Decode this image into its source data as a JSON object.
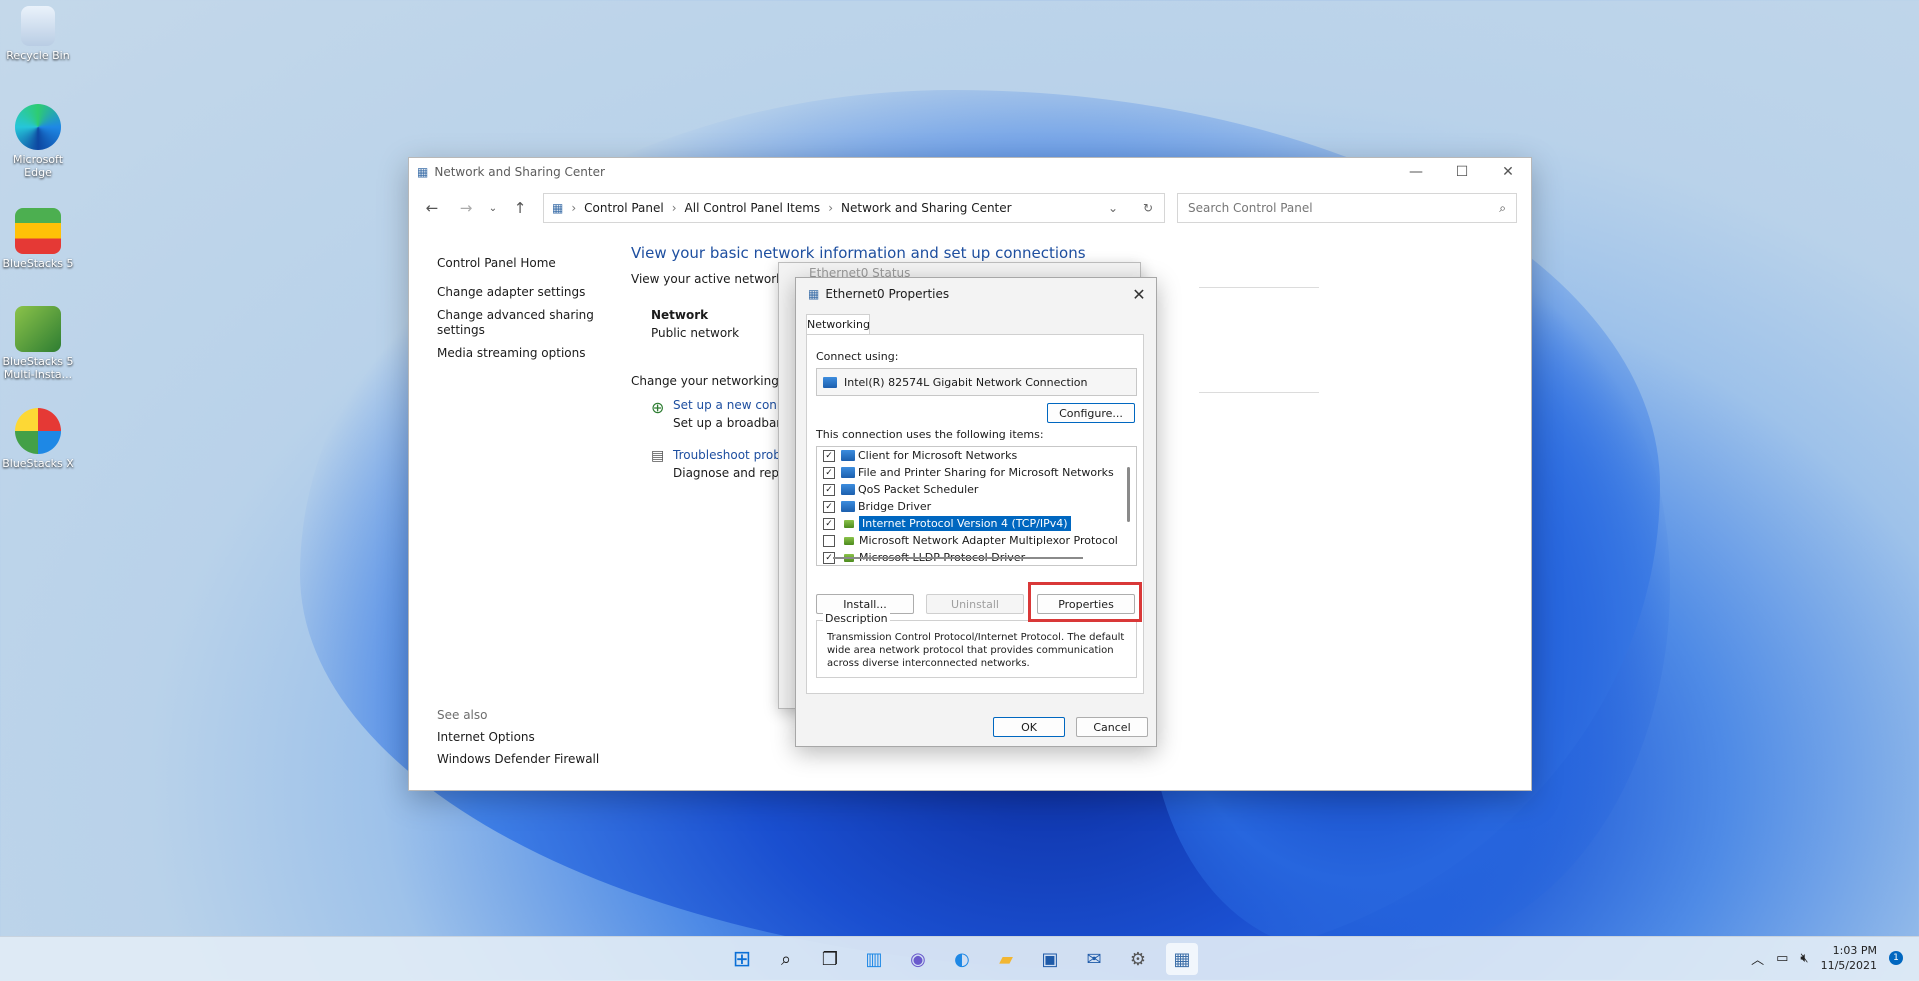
{
  "desktop": {
    "icons": [
      {
        "label": "Recycle Bin"
      },
      {
        "label": "Microsoft Edge"
      },
      {
        "label": "BlueStacks 5"
      },
      {
        "label": "BlueStacks 5 Multi-Insta..."
      },
      {
        "label": "BlueStacks X"
      }
    ]
  },
  "window": {
    "title": "Network and Sharing Center",
    "breadcrumb": [
      "Control Panel",
      "All Control Panel Items",
      "Network and Sharing Center"
    ],
    "search_placeholder": "Search Control Panel",
    "left_nav": [
      "Control Panel Home",
      "Change adapter settings",
      "Change advanced sharing settings",
      "Media streaming options"
    ],
    "see_also_heading": "See also",
    "see_also": [
      "Internet Options",
      "Windows Defender Firewall"
    ],
    "heading": "View your basic network information and set up connections",
    "active_networks_label": "View your active networks",
    "network_name": "Network",
    "network_type": "Public network",
    "change_settings_label": "Change your networking set",
    "setup_link": "Set up a new conn",
    "setup_desc": "Set up a broadban",
    "troubleshoot_link": "Troubleshoot prob",
    "troubleshoot_desc": "Diagnose and rep"
  },
  "status_dialog": {
    "title": "Ethernet0 Status"
  },
  "properties_dialog": {
    "title": "Ethernet0 Properties",
    "tab": "Networking",
    "connect_using_label": "Connect using:",
    "adapter": "Intel(R) 82574L Gigabit Network Connection",
    "configure_button": "Configure...",
    "items_label": "This connection uses the following items:",
    "items": [
      {
        "label": "Client for Microsoft Networks",
        "checked": true,
        "selected": false
      },
      {
        "label": "File and Printer Sharing for Microsoft Networks",
        "checked": true,
        "selected": false
      },
      {
        "label": "QoS Packet Scheduler",
        "checked": true,
        "selected": false
      },
      {
        "label": "Bridge Driver",
        "checked": true,
        "selected": false
      },
      {
        "label": "Internet Protocol Version 4 (TCP/IPv4)",
        "checked": true,
        "selected": true
      },
      {
        "label": "Microsoft Network Adapter Multiplexor Protocol",
        "checked": false,
        "selected": false
      },
      {
        "label": "Microsoft LLDP Protocol Driver",
        "checked": true,
        "selected": false
      }
    ],
    "install_button": "Install...",
    "uninstall_button": "Uninstall",
    "properties_button": "Properties",
    "description_label": "Description",
    "description": "Transmission Control Protocol/Internet Protocol. The default wide area network protocol that provides communication across diverse interconnected networks.",
    "ok_button": "OK",
    "cancel_button": "Cancel"
  },
  "taskbar": {
    "time": "1:03 PM",
    "date": "11/5/2021",
    "notification_count": "1",
    "apps": [
      "start-icon",
      "search-icon",
      "task-view-icon",
      "widgets-icon",
      "chat-icon",
      "edge-icon",
      "file-explorer-icon",
      "store-icon",
      "mail-icon",
      "settings-icon",
      "control-panel-icon"
    ]
  },
  "colors": {
    "accent": "#0067c0",
    "highlight_box": "#d93838",
    "link": "#1e4fa0"
  }
}
